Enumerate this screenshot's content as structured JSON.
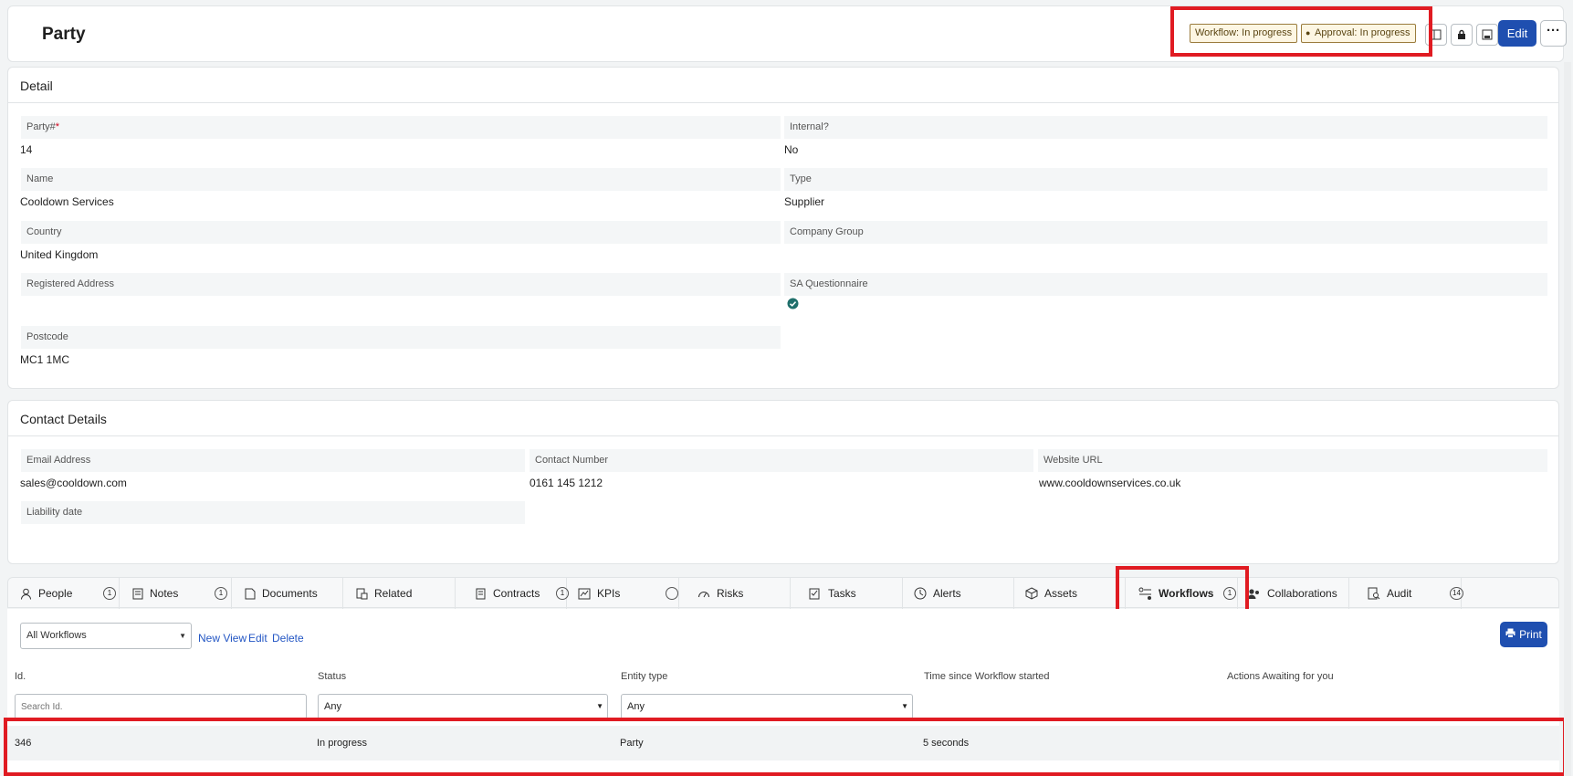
{
  "header": {
    "title": "Party",
    "workflow_badge": "Workflow: In progress",
    "approval_badge": "Approval: In progress",
    "edit_label": "Edit",
    "more_label": "···"
  },
  "detail": {
    "title": "Detail",
    "fields": {
      "party_label": "Party#",
      "party_req": "*",
      "party_value": "14",
      "internal_label": "Internal?",
      "internal_value": "No",
      "name_label": "Name",
      "name_value": "Cooldown Services",
      "type_label": "Type",
      "type_value": "Supplier",
      "country_label": "Country",
      "country_value": "United Kingdom",
      "company_group_label": "Company Group",
      "registered_address_label": "Registered Address",
      "sa_questionnaire_label": "SA Questionnaire",
      "postcode_label": "Postcode",
      "postcode_value": "MC1 1MC"
    }
  },
  "contact": {
    "title": "Contact Details",
    "email_label": "Email Address",
    "email_value": "sales@cooldown.com",
    "phone_label": "Contact Number",
    "phone_value": "0161 145 1212",
    "website_label": "Website URL",
    "website_value": "www.cooldownservices.co.uk",
    "liability_label": "Liability date"
  },
  "tabs": [
    {
      "label": "People",
      "count": "1"
    },
    {
      "label": "Notes",
      "count": "1"
    },
    {
      "label": "Documents"
    },
    {
      "label": "Related"
    },
    {
      "label": "Contracts",
      "count": "1"
    },
    {
      "label": "KPIs",
      "count": ""
    },
    {
      "label": "Risks"
    },
    {
      "label": "Tasks"
    },
    {
      "label": "Alerts"
    },
    {
      "label": "Assets"
    },
    {
      "label": "Workflows",
      "count": "1"
    },
    {
      "label": "Collaborations"
    },
    {
      "label": "Audit",
      "count": "14"
    }
  ],
  "workflows": {
    "view_select": "All Workflows",
    "new_view": "New View",
    "edit": "Edit",
    "delete": "Delete",
    "print": "Print",
    "columns": [
      "Id.",
      "Status",
      "Entity type",
      "Time since Workflow started",
      "Actions Awaiting for you"
    ],
    "id_placeholder": "Search Id.",
    "status_filter": "Any",
    "entity_filter": "Any",
    "rows": [
      {
        "id": "346",
        "status": "In progress",
        "entity": "Party",
        "time": "5 seconds",
        "actions": ""
      }
    ]
  },
  "colors": {
    "accent": "#1f4fb0",
    "highlight": "#e01b22",
    "badge_bg": "#fdf6e3",
    "check": "#1f6f6b"
  }
}
